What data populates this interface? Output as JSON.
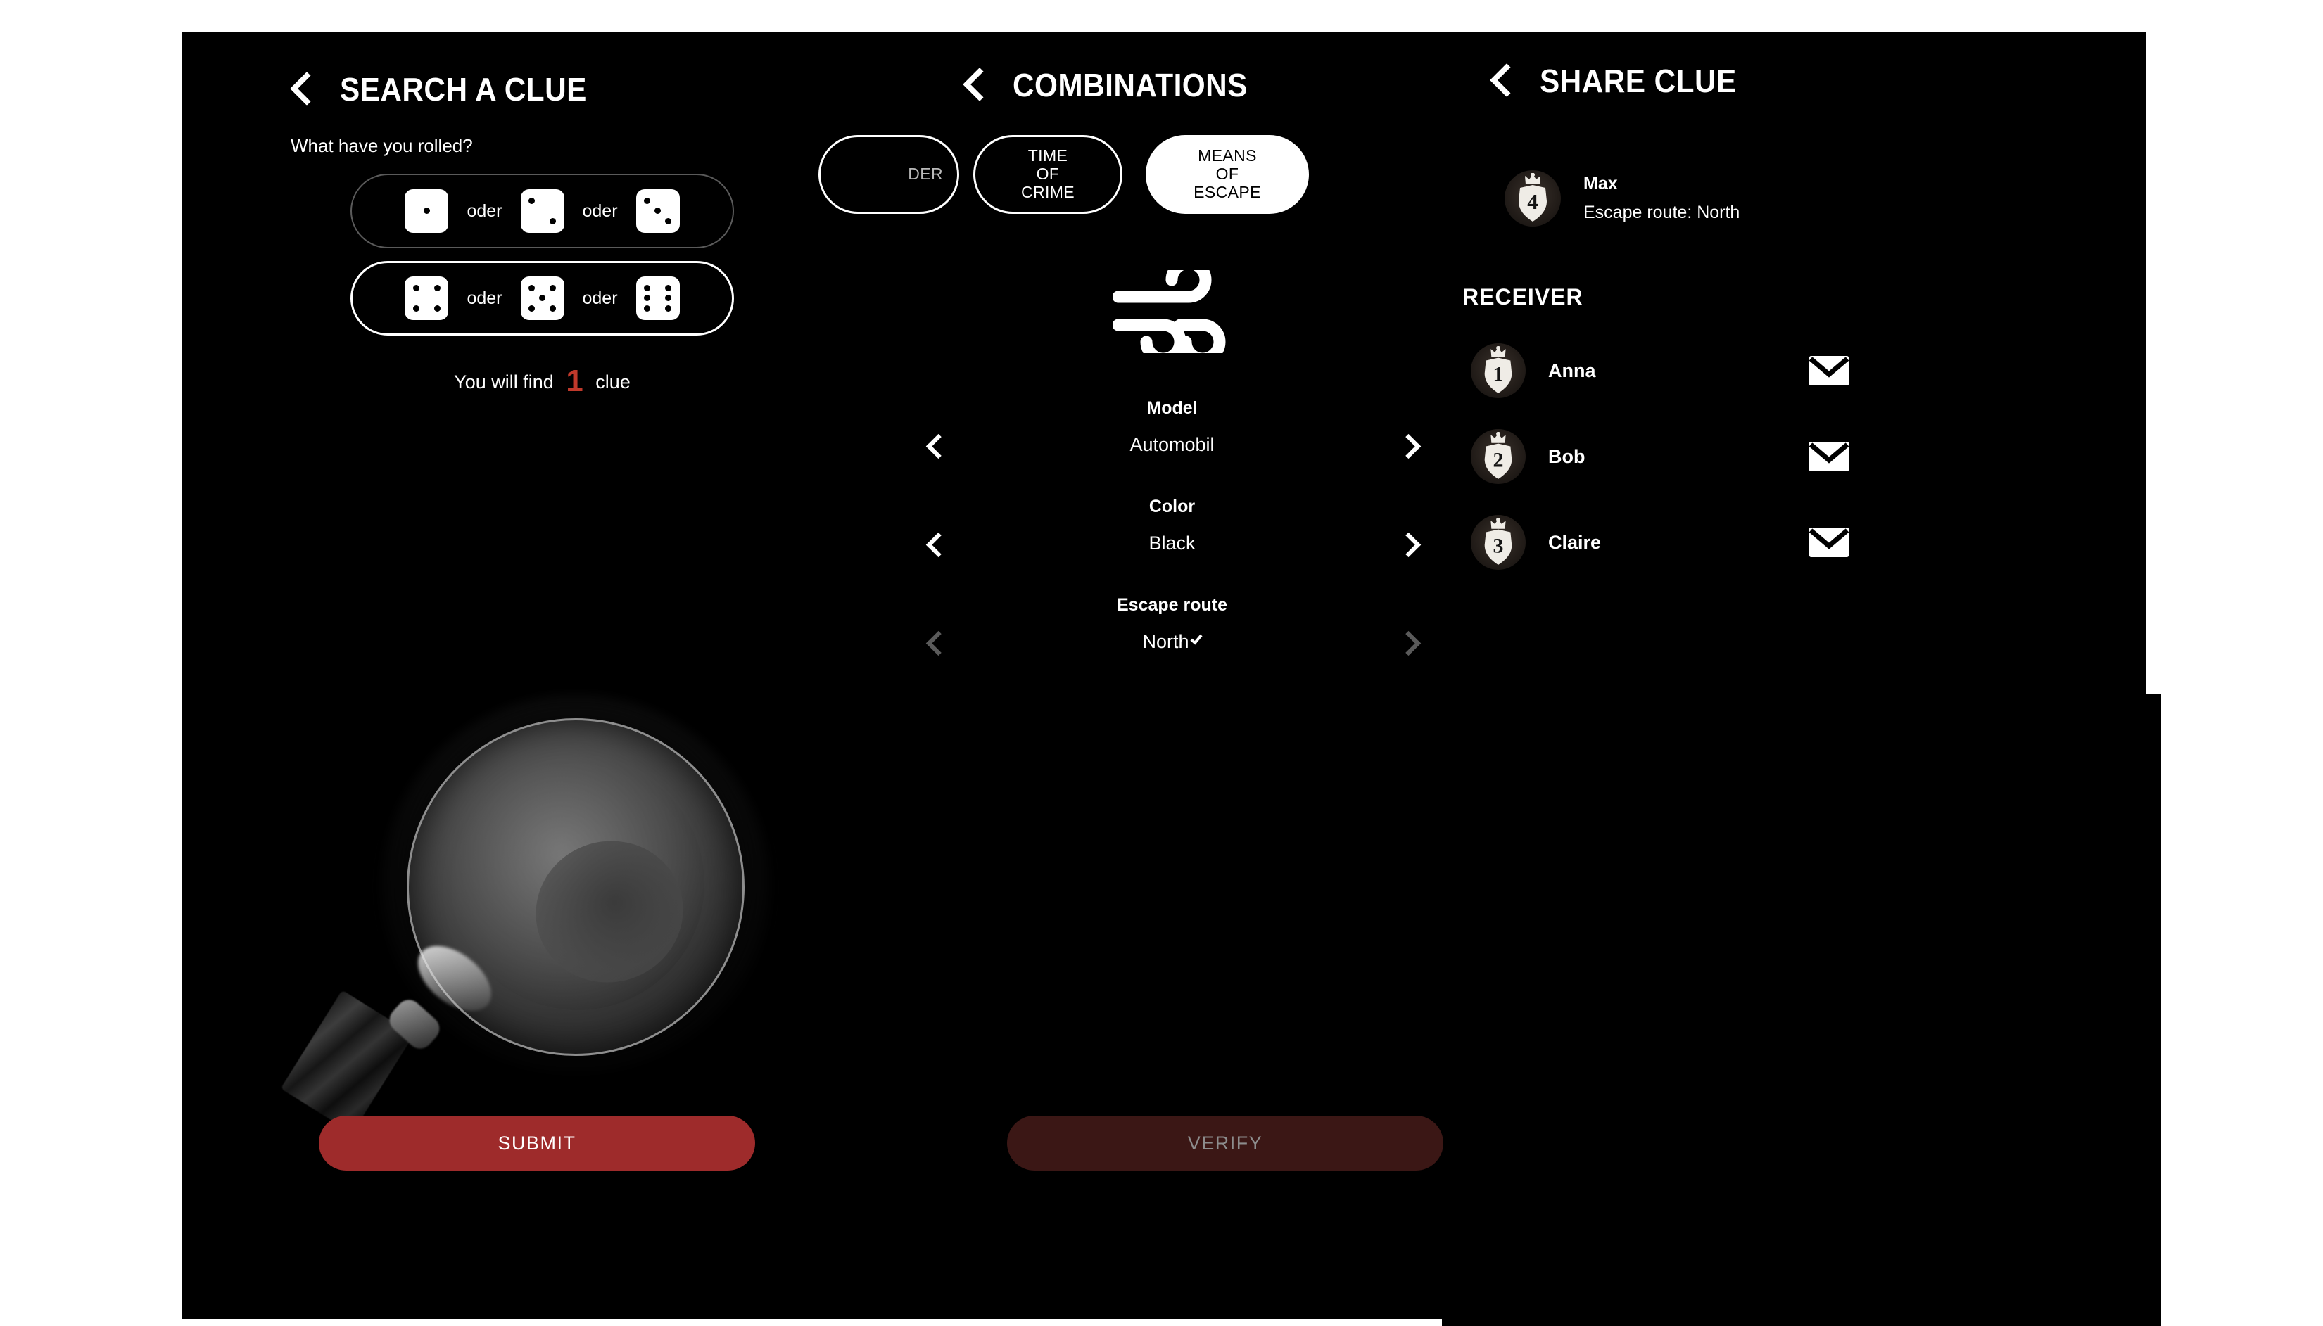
{
  "theme": {
    "bg": "#000000",
    "accent_red": "#9e2b2b",
    "disabled_red": "#3b1715",
    "clue_number_color": "#c0392b"
  },
  "search_panel": {
    "title": "SEARCH A CLUE",
    "back_icon": "chevron-left-icon",
    "question": "What have you rolled?",
    "dice_rows": [
      {
        "selected": false,
        "options": [
          1,
          2,
          3
        ],
        "separator": "oder"
      },
      {
        "selected": true,
        "options": [
          4,
          5,
          6
        ],
        "separator": "oder"
      }
    ],
    "result_prefix": "You will find",
    "result_count": "1",
    "result_suffix": "clue",
    "illustration": "magnifying-glass-photo",
    "submit_label": "SUBMIT"
  },
  "combinations_panel": {
    "title": "COMBINATIONS",
    "back_icon": "chevron-left-icon",
    "tabs": [
      {
        "label": "DER",
        "selected": false,
        "clipped": true
      },
      {
        "label": "TIME\nOF\nCRIME",
        "line1": "TIME",
        "line2": "OF",
        "line3": "CRIME",
        "selected": false
      },
      {
        "label": "MEANS\nOF\nESCAPE",
        "line1": "MEANS",
        "line2": "OF",
        "line3": "ESCAPE",
        "selected": true
      }
    ],
    "category_icon": "wind-icon",
    "attributes": [
      {
        "label": "Model",
        "value": "Automobil",
        "confirmed": false,
        "arrows_enabled": true
      },
      {
        "label": "Color",
        "value": "Black",
        "confirmed": false,
        "arrows_enabled": true
      },
      {
        "label": "Escape route",
        "value": "North",
        "confirmed": true,
        "arrows_enabled": false
      }
    ],
    "verify_label": "VERIFY",
    "verify_disabled": true
  },
  "share_panel": {
    "title": "SHARE CLUE",
    "back_icon": "chevron-left-icon",
    "owner": {
      "badge_number": "4",
      "name": "Max",
      "detail": "Escape route: North",
      "avatar": "crown-shield-avatar"
    },
    "receiver_heading": "RECEIVER",
    "receivers": [
      {
        "badge_number": "1",
        "name": "Anna",
        "action_icon": "envelope-icon"
      },
      {
        "badge_number": "2",
        "name": "Bob",
        "action_icon": "envelope-icon"
      },
      {
        "badge_number": "3",
        "name": "Claire",
        "action_icon": "envelope-icon"
      }
    ]
  }
}
